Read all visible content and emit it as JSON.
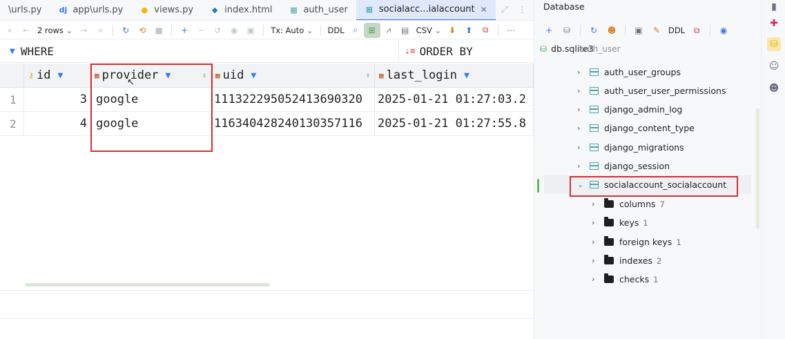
{
  "tabs": [
    {
      "label": "\\urls.py",
      "icon": "python-icon",
      "icon_glyph": "",
      "color": "#3574f0",
      "active": false
    },
    {
      "label": "app\\urls.py",
      "icon": "django-icon",
      "icon_glyph": "dj",
      "color": "#3574f0",
      "active": false
    },
    {
      "label": "views.py",
      "icon": "python-icon",
      "icon_glyph": "●",
      "color": "#f2b705",
      "active": false
    },
    {
      "label": "index.html",
      "icon": "html-icon",
      "icon_glyph": "◆",
      "color": "#1f7fc4",
      "active": false
    },
    {
      "label": "auth_user",
      "icon": "table-icon",
      "icon_glyph": "▦",
      "color": "#4aa5a5",
      "active": false
    },
    {
      "label": "socialacc...ialaccount",
      "icon": "table-icon",
      "icon_glyph": "▦",
      "color": "#4aa5a5",
      "active": true
    }
  ],
  "toolbar": {
    "rows_label": "2 rows",
    "tx_label": "Tx: Auto",
    "ddl_label": "DDL",
    "csv_label": "CSV"
  },
  "filter": {
    "where_label": "WHERE",
    "orderby_label": "ORDER BY"
  },
  "grid": {
    "columns": [
      {
        "name": "id",
        "icon": "key-icon"
      },
      {
        "name": "provider",
        "icon": "column-icon"
      },
      {
        "name": "uid",
        "icon": "column-icon"
      },
      {
        "name": "last_login",
        "icon": "column-icon"
      }
    ],
    "rows": [
      {
        "num": "1",
        "id": "3",
        "provider": "google",
        "uid": "111322295052413690320",
        "last_login": "2025-01-21 01:27:03.2"
      },
      {
        "num": "2",
        "id": "4",
        "provider": "google",
        "uid": "116340428240130357116",
        "last_login": "2025-01-21 01:27:55.8"
      }
    ]
  },
  "database": {
    "title": "Database",
    "ddl_label": "DDL",
    "root": "db.sqlite3",
    "tables": [
      "auth_user",
      "auth_user_groups",
      "auth_user_user_permissions",
      "django_admin_log",
      "django_content_type",
      "django_migrations",
      "django_session",
      "socialaccount_socialaccount"
    ],
    "children": [
      {
        "label": "columns",
        "count": "7"
      },
      {
        "label": "keys",
        "count": "1"
      },
      {
        "label": "foreign keys",
        "count": "1"
      },
      {
        "label": "indexes",
        "count": "2"
      },
      {
        "label": "checks",
        "count": "1"
      }
    ]
  },
  "colors": {
    "accent": "#3574f0",
    "highlight_box": "#d32f2f",
    "table_icon": "#4aa5a5"
  }
}
